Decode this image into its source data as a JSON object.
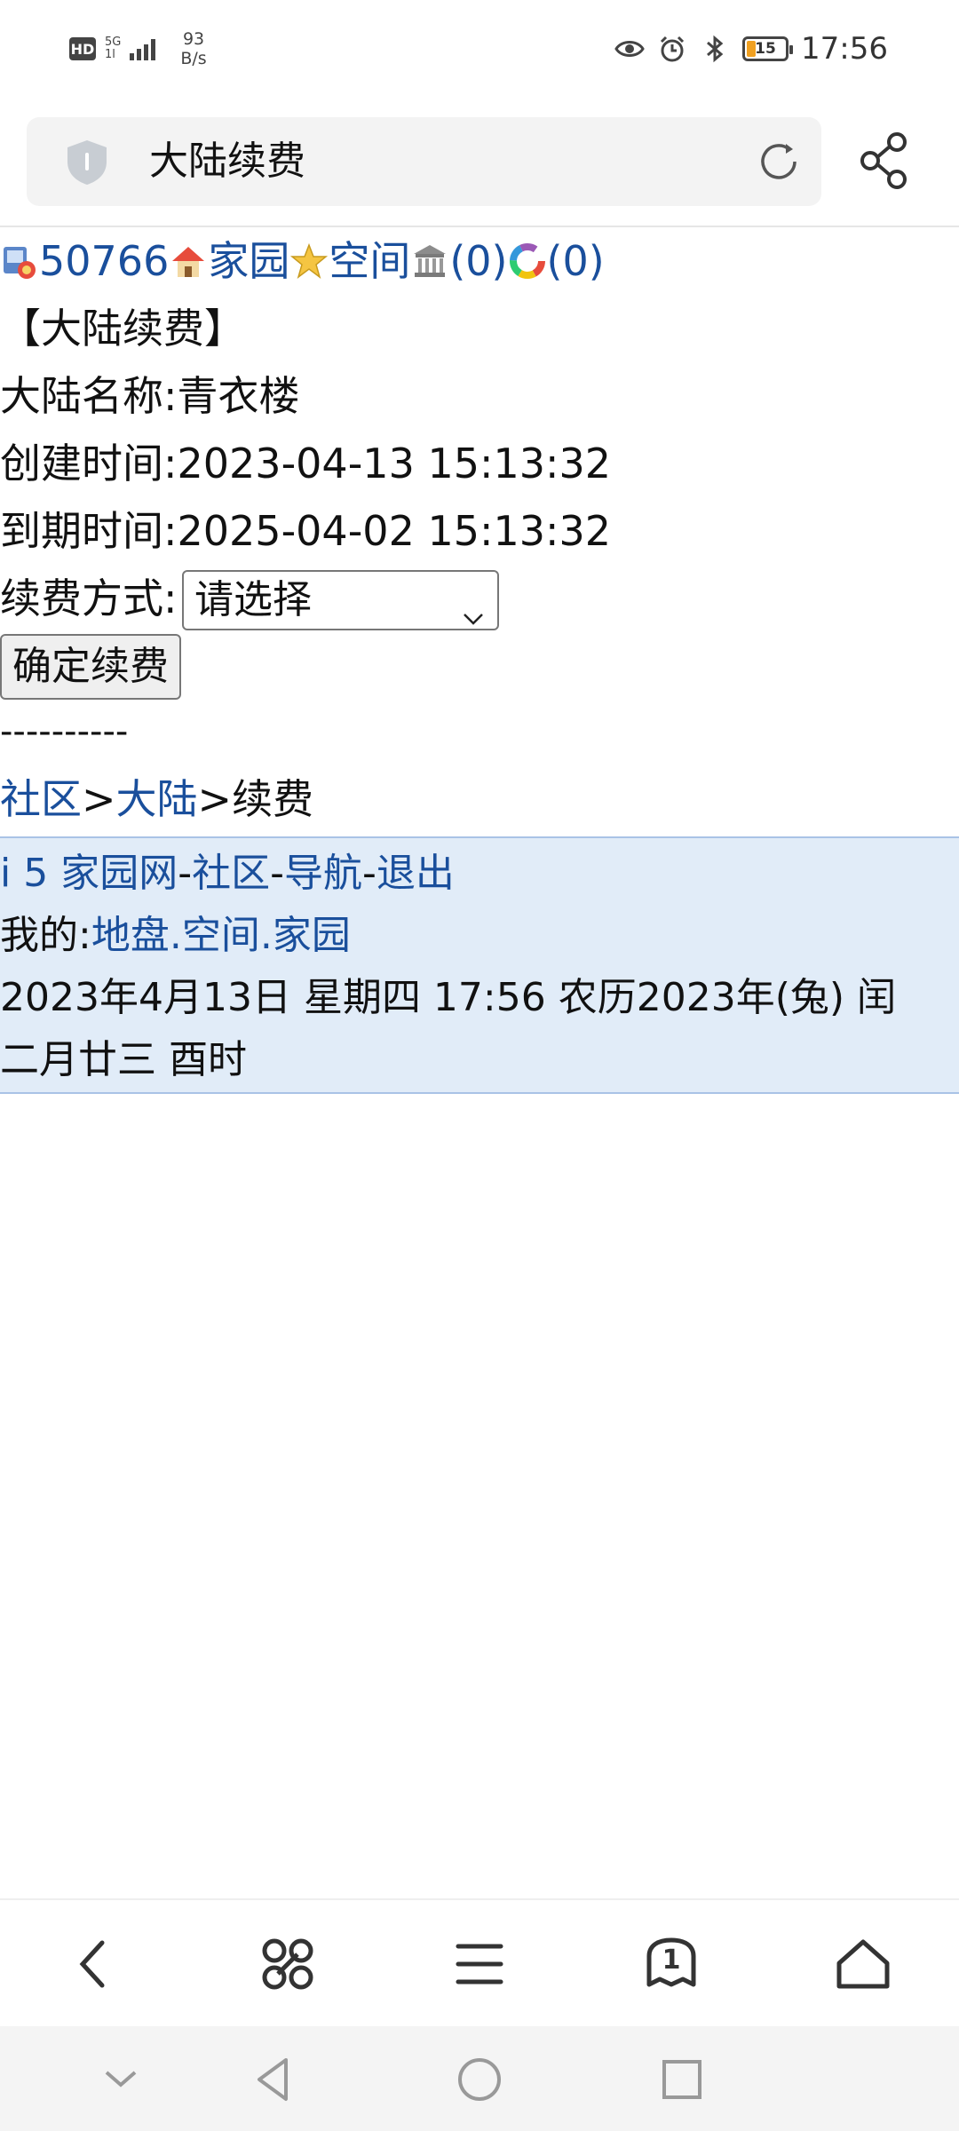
{
  "status_bar": {
    "hd": "HD",
    "network": "5G",
    "network_sub": "1l",
    "speed_value": "93",
    "speed_unit": "B/s",
    "battery": "15",
    "time": "17:56"
  },
  "address_bar": {
    "title": "大陆续费"
  },
  "topline": {
    "user_id": "50766",
    "home": "家园",
    "space": "空间",
    "count1": "(0)",
    "count2": "(0)"
  },
  "page": {
    "heading": "【大陆续费】",
    "name_label": "大陆名称:",
    "name_value": "青衣楼",
    "created_label": "创建时间:",
    "created_value": "2023-04-13 15:13:32",
    "expire_label": "到期时间:",
    "expire_value": "2025-04-02 15:13:32",
    "method_label": "续费方式:",
    "method_select": "请选择",
    "confirm_button": "确定续费",
    "separator": "----------"
  },
  "breadcrumb": {
    "community": "社区",
    "sep1": ">",
    "continent": "大陆",
    "sep2": ">",
    "current": "续费"
  },
  "footer": {
    "site": "i 5 家园网",
    "dash1": "-",
    "community": "社区",
    "dash2": "-",
    "nav": "导航",
    "dash3": "-",
    "logout": "退出",
    "mine_label": "我的:",
    "land": "地盘",
    "dot1": ".",
    "space": "空间",
    "dot2": ".",
    "home": "家园",
    "date_line1": "2023年4月13日  星期四  17:56  农历2023年(兔) 闰",
    "date_line2": "二月廿三  酉时"
  },
  "bottom_nav": {
    "tabs_count": "1"
  }
}
